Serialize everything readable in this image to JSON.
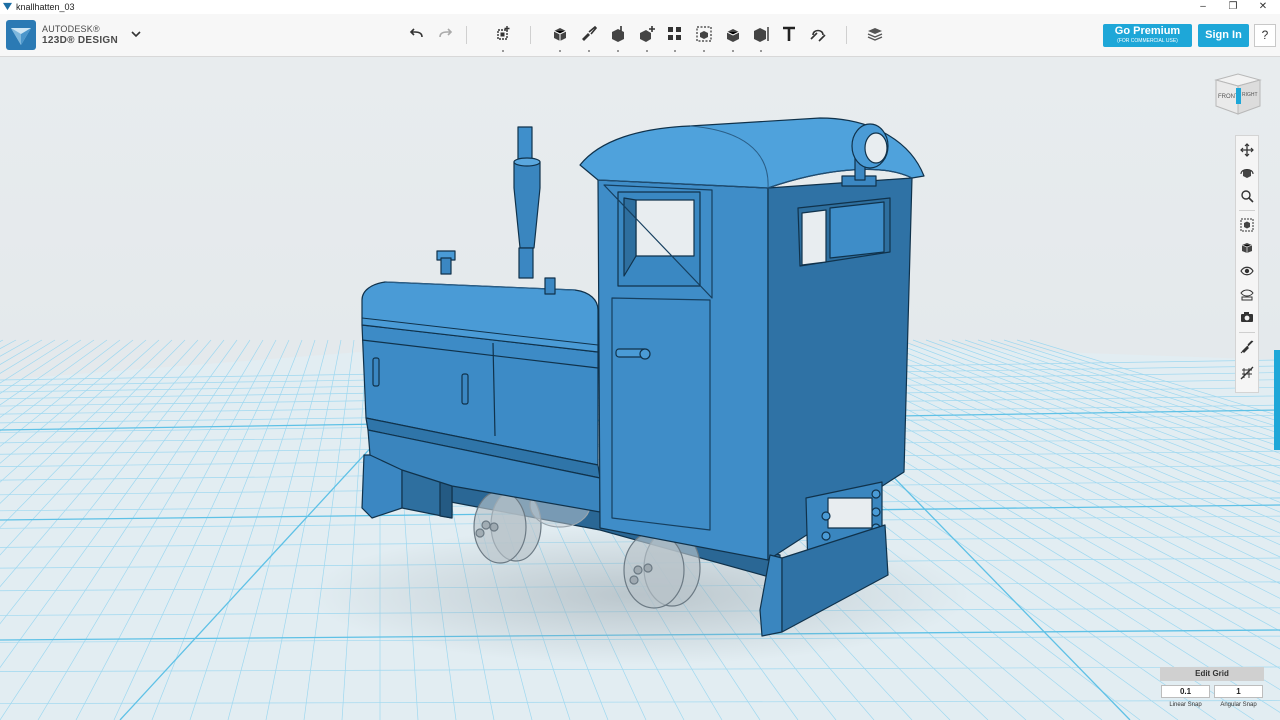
{
  "window": {
    "title": "knallhatten_03",
    "minimize": "–",
    "maximize": "❐",
    "close": "✕"
  },
  "brand": {
    "line1": "AUTODESK®",
    "line2": "123D® DESIGN"
  },
  "toolbar": {
    "tools": [
      "undo-icon",
      "redo-icon",
      "transform-icon",
      "primitives-icon",
      "sketch-icon",
      "construct-icon",
      "modify-icon",
      "pattern-icon",
      "grouping-icon",
      "combine-icon",
      "measure-icon",
      "text-icon",
      "snap-icon",
      "material-icon"
    ]
  },
  "account": {
    "premium_label": "Go Premium",
    "premium_sub": "(FOR COMMERCIAL USE)",
    "signin_label": "Sign In",
    "help_label": "?"
  },
  "viewcube": {
    "front": "FRONT",
    "right": "RIGHT"
  },
  "nav_tools": [
    "pan-icon",
    "orbit-icon",
    "zoom-icon",
    "fit-icon",
    "view-material-icon",
    "visibility-icon",
    "show-hide-icon",
    "screenshot-icon",
    "hide-sketch-icon",
    "hide-mesh-icon"
  ],
  "grid": {
    "edit_label": "Edit Grid",
    "linear_value": "0.1",
    "angular_value": "1",
    "linear_label": "Linear Snap",
    "angular_label": "Angular Snap"
  },
  "colors": {
    "accent": "#1ea7d8",
    "model": "#3b87c2",
    "grid": "#8fd1ec"
  }
}
